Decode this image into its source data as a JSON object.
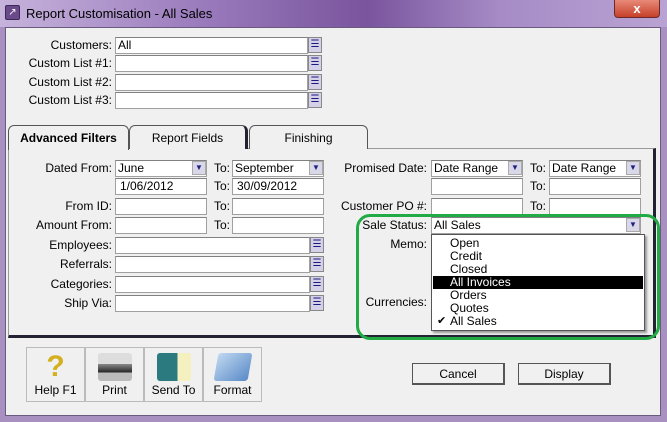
{
  "window": {
    "title": "Report Customisation - All Sales",
    "close_label": "x"
  },
  "top_filters": [
    {
      "label": "Customers:",
      "value": "All"
    },
    {
      "label": "Custom List #1:",
      "value": ""
    },
    {
      "label": "Custom List #2:",
      "value": ""
    },
    {
      "label": "Custom List #3:",
      "value": ""
    }
  ],
  "tabs": [
    {
      "label": "Advanced Filters",
      "active": true
    },
    {
      "label": "Report Fields"
    },
    {
      "label": "Finishing"
    }
  ],
  "left": {
    "dated_from_label": "Dated From:",
    "dated_from": "June",
    "to_label": "To:",
    "dated_to": "September",
    "date_from": "1/06/2012",
    "date_to": "30/09/2012",
    "from_id_label": "From ID:",
    "from_id": "",
    "from_id_to": "",
    "amount_from_label": "Amount From:",
    "amount_from": "",
    "amount_to": "",
    "lists": [
      {
        "label": "Employees:",
        "value": ""
      },
      {
        "label": "Referrals:",
        "value": ""
      },
      {
        "label": "Categories:",
        "value": ""
      },
      {
        "label": "Ship Via:",
        "value": ""
      }
    ]
  },
  "right": {
    "promised_label": "Promised Date:",
    "promised_from": "Date Range",
    "to_label": "To:",
    "promised_to": "Date Range",
    "customer_po_label": "Customer PO #:",
    "sale_status_label": "Sale Status:",
    "sale_status": "All Sales",
    "memo_label": "Memo:",
    "currencies_label": "Currencies:",
    "options": [
      "Open",
      "Credit",
      "Closed",
      "All Invoices",
      "Orders",
      "Quotes",
      "All Sales"
    ],
    "highlighted": "All Invoices",
    "checked": "All Sales"
  },
  "toolbar": [
    {
      "label": "Help F1"
    },
    {
      "label": "Print"
    },
    {
      "label": "Send To"
    },
    {
      "label": "Format"
    }
  ],
  "buttons": {
    "cancel": "Cancel",
    "display": "Display"
  },
  "colors": {
    "highlight": "#22aa44",
    "title_bar": "#7a559e"
  }
}
